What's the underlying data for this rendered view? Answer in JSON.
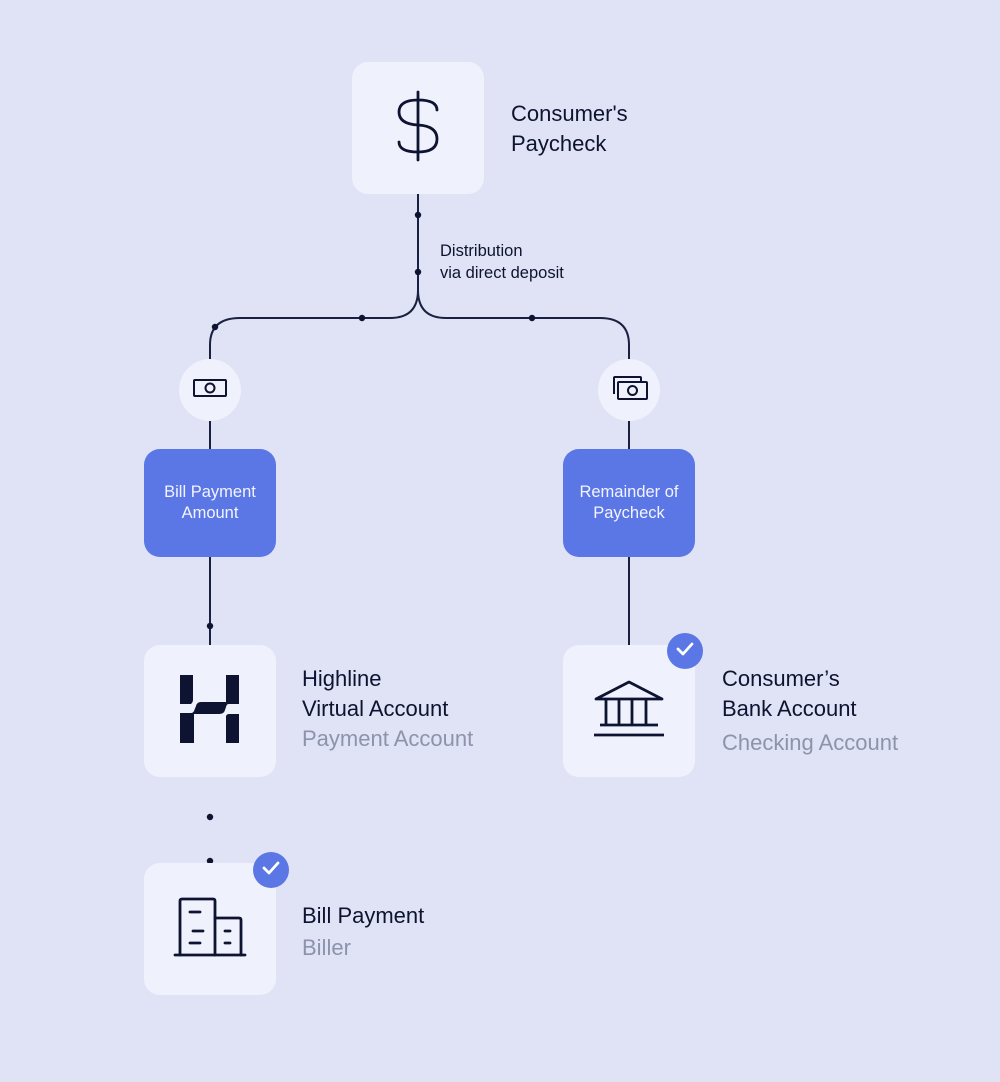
{
  "nodes": {
    "paycheck": {
      "icon": "dollar-icon",
      "title_line1": "Consumer's",
      "title_line2": "Paycheck"
    },
    "distribution": {
      "line1": "Distribution",
      "line2": "via direct deposit"
    },
    "left_branch": {
      "icon": "single-bill-icon",
      "amount_line1": "Bill Payment",
      "amount_line2": "Amount"
    },
    "right_branch": {
      "icon": "stacked-bills-icon",
      "amount_line1": "Remainder of",
      "amount_line2": "Paycheck"
    },
    "highline": {
      "icon": "highline-logo-icon",
      "title_line1": "Highline",
      "title_line2": "Virtual Account",
      "subtitle": "Payment Account"
    },
    "bank": {
      "icon": "bank-icon",
      "verified": true,
      "title_line1": "Consumer’s",
      "title_line2": "Bank Account",
      "subtitle": "Checking Account"
    },
    "biller": {
      "icon": "buildings-icon",
      "verified": true,
      "title": "Bill Payment",
      "subtitle": "Biller"
    }
  },
  "colors": {
    "background": "#dfe3f5",
    "card": "#eff2fc",
    "accent": "#5b76e5",
    "ink": "#0d1330",
    "muted": "#8c93ab"
  }
}
